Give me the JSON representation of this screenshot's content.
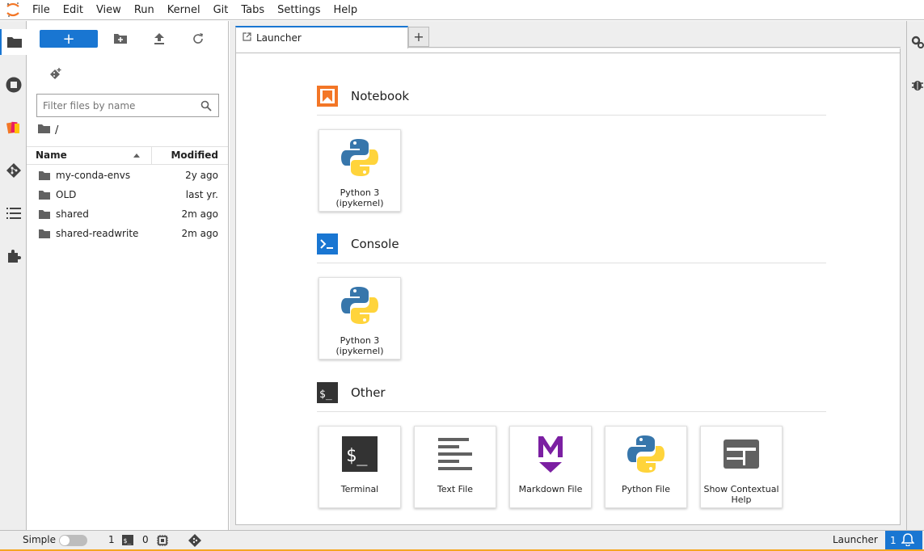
{
  "menubar": {
    "items": [
      "File",
      "Edit",
      "View",
      "Run",
      "Kernel",
      "Git",
      "Tabs",
      "Settings",
      "Help"
    ]
  },
  "colors": {
    "accent": "#1976d2",
    "notebook_orange": "#f37626",
    "markdown_purple": "#7b1fa2",
    "python_blue": "#3776ab",
    "python_yellow": "#ffd43b"
  },
  "leftbar": {
    "icons": [
      "folder-icon",
      "running-icon",
      "extension-manager-icon",
      "git-icon",
      "table-of-contents-icon",
      "puzzle-icon"
    ]
  },
  "filebrowser": {
    "new_button_label": "+",
    "filter_placeholder": "Filter files by name",
    "breadcrumb": "/",
    "columns": {
      "name": "Name",
      "modified": "Modified"
    },
    "files": [
      {
        "name": "my-conda-envs",
        "modified": "2y ago"
      },
      {
        "name": "OLD",
        "modified": "last yr."
      },
      {
        "name": "shared",
        "modified": "2m ago"
      },
      {
        "name": "shared-readwrite",
        "modified": "2m ago"
      }
    ]
  },
  "tabs": {
    "active_label": "Launcher",
    "add_label": "+"
  },
  "launcher": {
    "sections": [
      {
        "title": "Notebook",
        "cards": [
          {
            "label_line1": "Python 3",
            "label_line2": "(ipykernel)"
          }
        ]
      },
      {
        "title": "Console",
        "cards": [
          {
            "label_line1": "Python 3",
            "label_line2": "(ipykernel)"
          }
        ]
      },
      {
        "title": "Other",
        "cards": [
          {
            "label_line1": "Terminal",
            "label_line2": ""
          },
          {
            "label_line1": "Text File",
            "label_line2": ""
          },
          {
            "label_line1": "Markdown File",
            "label_line2": ""
          },
          {
            "label_line1": "Python File",
            "label_line2": ""
          },
          {
            "label_line1": "Show Contextual",
            "label_line2": "Help"
          }
        ]
      }
    ],
    "console_prompt": ">_",
    "terminal_prompt": "$_",
    "markdown_letter": "M"
  },
  "rightbar": {
    "icons": [
      "property-inspector-icon",
      "debugger-icon"
    ]
  },
  "statusbar": {
    "mode_label": "Simple",
    "terminals_count": "1",
    "kernels_count": "0",
    "right_label": "Launcher",
    "notification_count": "1"
  }
}
